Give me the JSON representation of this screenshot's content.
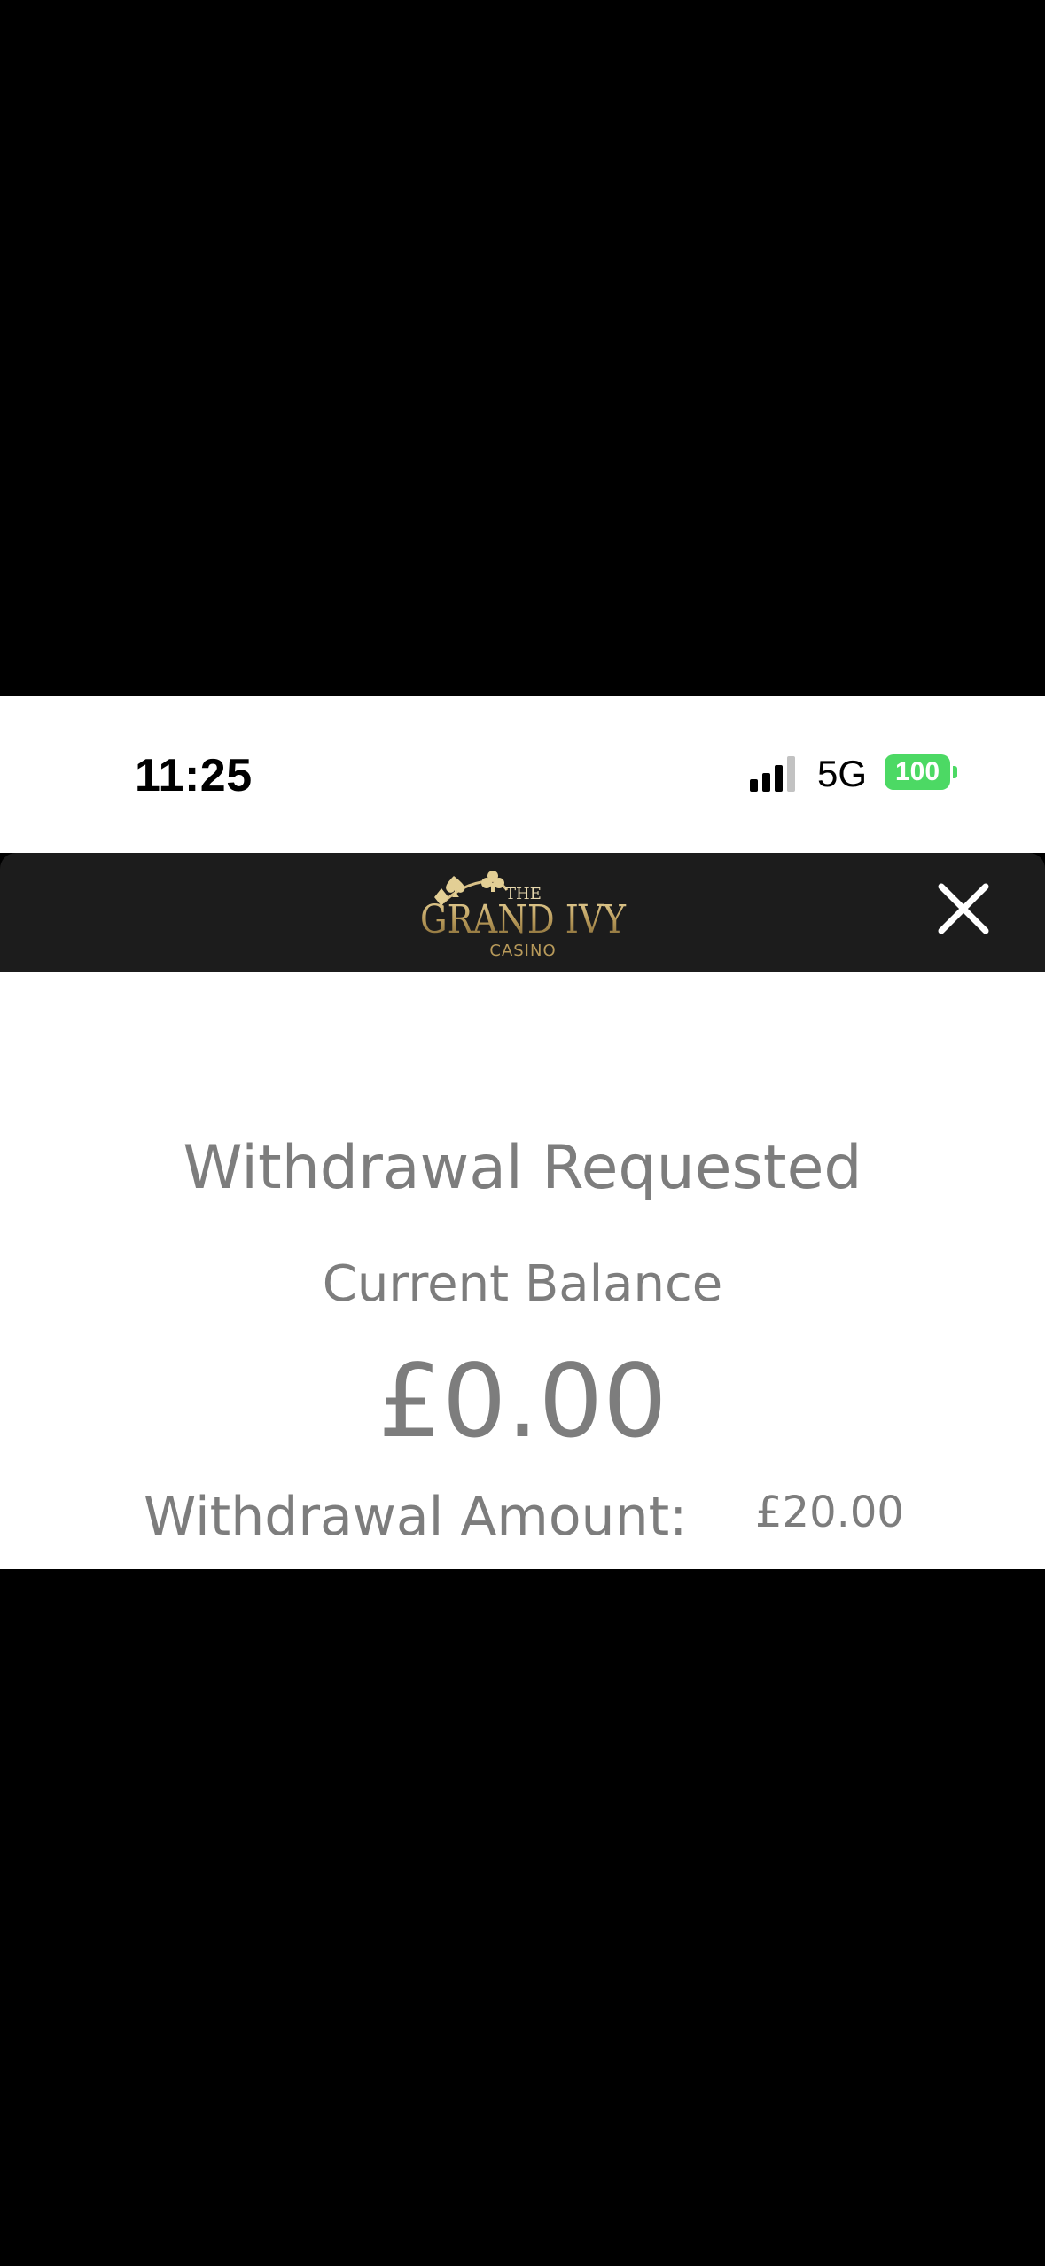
{
  "status_bar": {
    "time": "11:25",
    "network": "5G",
    "battery": "100",
    "battery_color": "#4cd964"
  },
  "header": {
    "logo": {
      "line1": "THE",
      "line2": "GRAND IVY",
      "line3": "CASINO",
      "gold_color": "#b89a5a"
    },
    "close_icon": "close-icon",
    "background_color": "#1c1c1c"
  },
  "main": {
    "title": "Withdrawal Requested",
    "balance_label": "Current Balance",
    "balance_value": "£0.00",
    "amount_label": "Withdrawal Amount:",
    "amount_value": "£20.00",
    "text_color": "#7d7d7d"
  }
}
